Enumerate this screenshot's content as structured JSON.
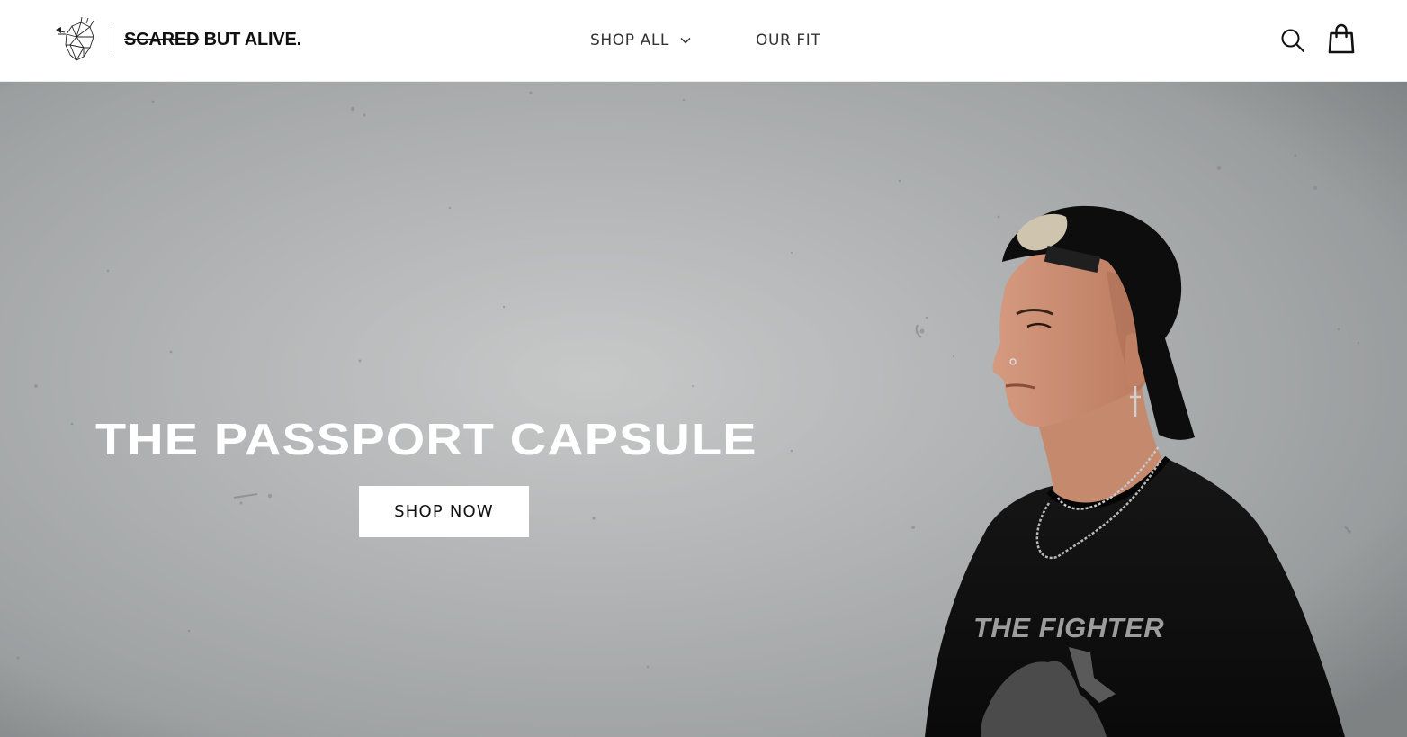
{
  "brand": {
    "name_struck": "SCARED",
    "name_rest": " BUT ALIVE.",
    "logo_icon": "geometric-heart-icon"
  },
  "nav": {
    "shop_all_label": "SHOP ALL",
    "our_fit_label": "OUR FIT",
    "shop_all_icon": "chevron-down-icon"
  },
  "header_actions": {
    "search_icon": "search-icon",
    "cart_icon": "shopping-bag-icon"
  },
  "hero": {
    "title": "THE PASSPORT CAPSULE",
    "cta_label": "SHOP NOW",
    "shirt_text": "THE FIGHTER"
  },
  "colors": {
    "header_bg": "#ffffff",
    "hero_bg": "#bcbebf",
    "text_dark": "#111111",
    "cta_bg": "#ffffff"
  }
}
